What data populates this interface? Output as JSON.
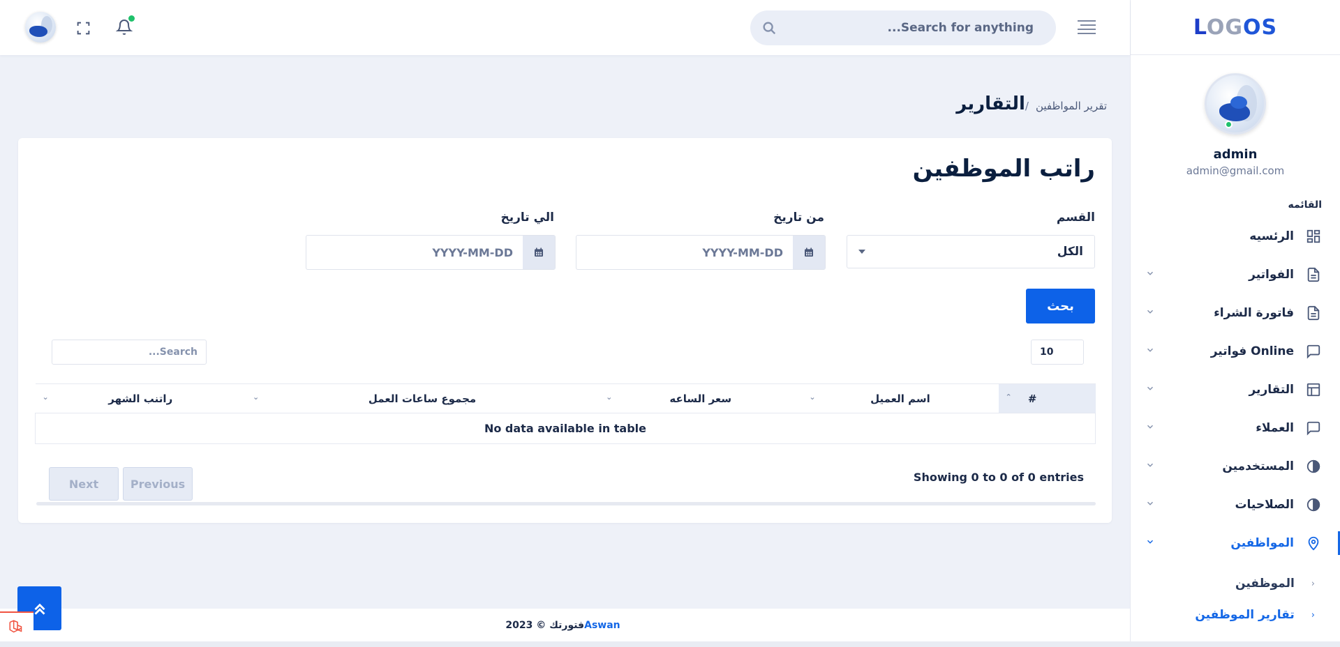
{
  "logo": {
    "part1": "L",
    "part2": "OG",
    "part3": "OS"
  },
  "header": {
    "search_placeholder": "Search for anything..."
  },
  "profile": {
    "name": "admin",
    "email": "admin@gmail.com"
  },
  "sidebar": {
    "menu_title": "القائمه",
    "items": [
      {
        "label": "الرئسيه",
        "icon": "dashboard-icon",
        "has_chevron": false
      },
      {
        "label": "الفواتير",
        "icon": "document-icon",
        "has_chevron": true
      },
      {
        "label": "فاتورة الشراء",
        "icon": "document-icon",
        "has_chevron": true
      },
      {
        "label": "فواتير Online",
        "icon": "chat-icon",
        "has_chevron": true
      },
      {
        "label": "التقارير",
        "icon": "table-icon",
        "has_chevron": true
      },
      {
        "label": "العملاء",
        "icon": "chat-icon",
        "has_chevron": true
      },
      {
        "label": "المستخدمين",
        "icon": "half-circle-icon",
        "has_chevron": true
      },
      {
        "label": "الصلاحيات",
        "icon": "half-circle-icon",
        "has_chevron": true
      },
      {
        "label": "المواظفين",
        "icon": "map-pin-icon",
        "has_chevron": true,
        "active": true
      }
    ],
    "sub_items": [
      {
        "label": "الموظفين"
      },
      {
        "label": "تقارير الموظفين",
        "active": true
      }
    ]
  },
  "page": {
    "title": "التقارير",
    "breadcrumb_sep": "/",
    "breadcrumb": "تقرير المواظفين"
  },
  "card": {
    "title": "راتب الموظفين",
    "department_label": "القسم",
    "department_value": "الكل",
    "from_label": "من تاريخ",
    "to_label": "الي تاريخ",
    "date_placeholder": "YYYY-MM-DD",
    "search_button": "بحث"
  },
  "table": {
    "page_length": "10",
    "search_placeholder": "Search...",
    "columns": [
      "#",
      "اسم العميل",
      "سعر الساعه",
      "مجموع ساعات العمل",
      "راتنب الشهر"
    ],
    "empty_text": "No data available in table",
    "info": "Showing 0 to 0 of 0 entries",
    "next": "Next",
    "previous": "Previous"
  },
  "footer": {
    "text": "فتورتك © 2023",
    "brand": "Aswan"
  },
  "colors": {
    "accent": "#0d62e8",
    "active": "#1467e6",
    "online": "#1fc16b",
    "background": "#eef1f8"
  }
}
